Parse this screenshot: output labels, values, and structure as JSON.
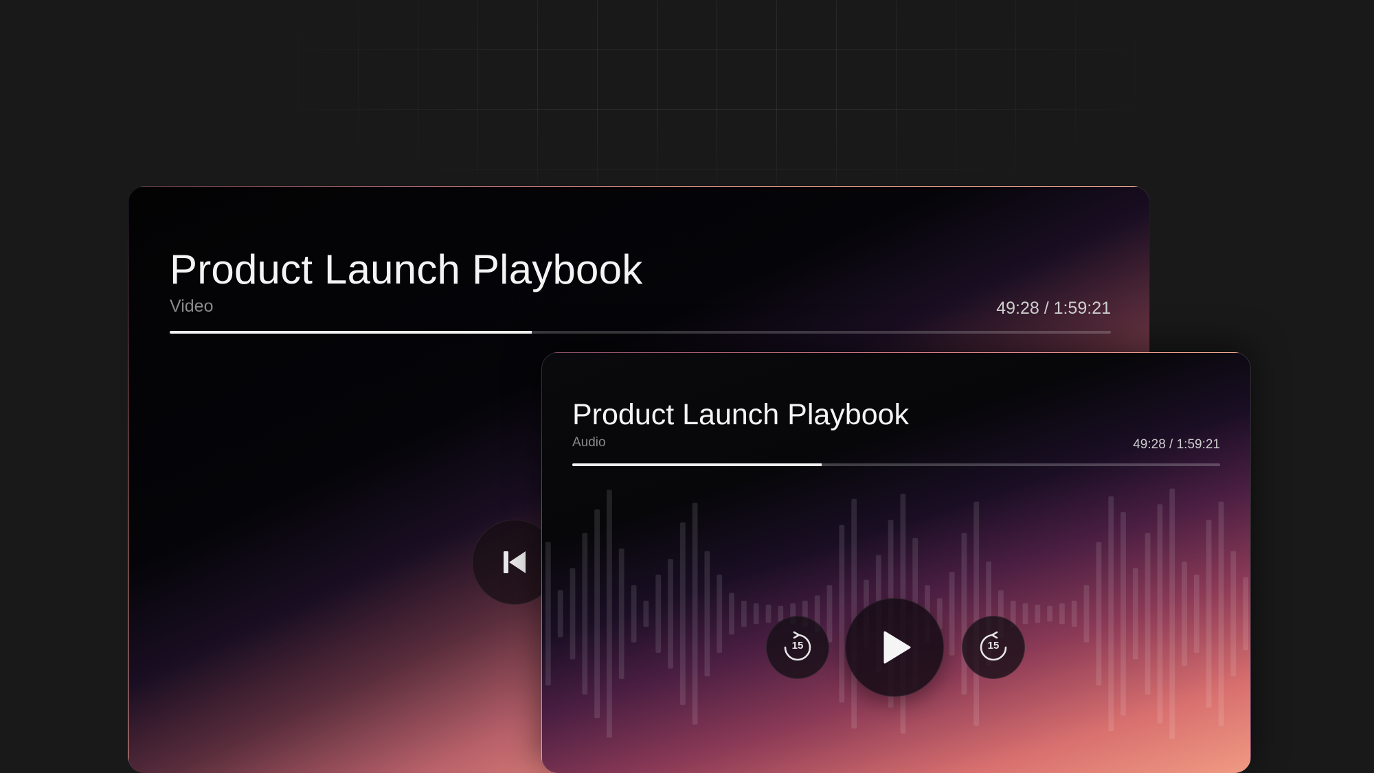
{
  "video_player": {
    "title": "Product Launch Playbook",
    "subtitle": "Video",
    "time": "49:28 / 1:59:21",
    "progress": 0.385,
    "icons": {
      "previous": "skip-previous-icon"
    }
  },
  "audio_player": {
    "title": "Product Launch Playbook",
    "subtitle": "Audio",
    "time": "49:28 / 1:59:21",
    "progress": 0.385,
    "rewind_label": "15",
    "forward_label": "15",
    "icons": {
      "rewind": "rewind-15-icon",
      "play": "play-icon",
      "forward": "forward-15-icon"
    }
  }
}
